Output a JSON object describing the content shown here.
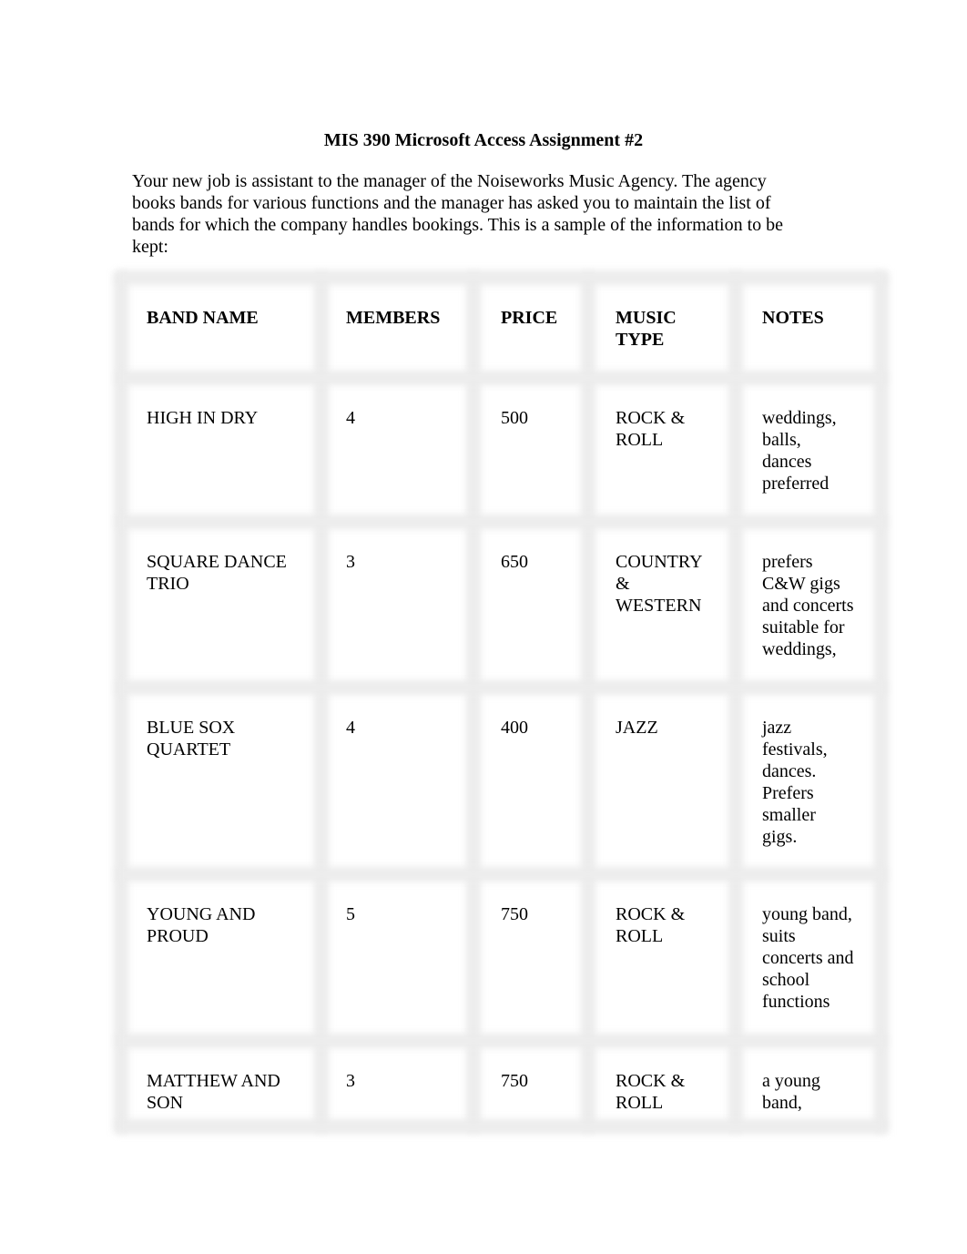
{
  "document": {
    "title": "MIS 390 Microsoft Access Assignment #2",
    "intro_lines": [
      "Your new job is assistant to the manager of the Noiseworks Music Agency. The agency",
      "books bands for various functions and the manager has asked you to maintain the list of",
      "bands for which the company handles bookings. This is a sample of the information to be",
      "kept:"
    ]
  },
  "table": {
    "headers": [
      [
        "BAND NAME"
      ],
      [
        "MEMBERS"
      ],
      [
        "PRICE"
      ],
      [
        "MUSIC",
        "TYPE"
      ],
      [
        "NOTES"
      ]
    ],
    "rows": [
      {
        "band_name": [
          "HIGH IN DRY"
        ],
        "members": "4",
        "price": "500",
        "music_type": [
          "ROCK &",
          "ROLL"
        ],
        "notes": [
          "weddings,",
          "balls,",
          "dances",
          "preferred"
        ]
      },
      {
        "band_name": [
          "SQUARE DANCE",
          "TRIO"
        ],
        "members": "3",
        "price": "650",
        "music_type": [
          "COUNTRY",
          "&",
          "WESTERN"
        ],
        "notes": [
          "prefers",
          "C&W gigs",
          "and concerts",
          "suitable for",
          "weddings,"
        ]
      },
      {
        "band_name": [
          "BLUE SOX",
          "QUARTET"
        ],
        "members": "4",
        "price": "400",
        "music_type": [
          "JAZZ"
        ],
        "notes": [
          "jazz",
          "festivals,",
          "dances.",
          "Prefers",
          "smaller",
          "gigs."
        ]
      },
      {
        "band_name": [
          "YOUNG AND",
          "PROUD"
        ],
        "members": "5",
        "price": "750",
        "music_type": [
          "ROCK &",
          "ROLL"
        ],
        "notes": [
          "young band,",
          "suits",
          "concerts and",
          "school",
          "functions"
        ]
      },
      {
        "band_name": [
          "MATTHEW AND",
          "SON"
        ],
        "members": "3",
        "price": "750",
        "music_type": [
          "ROCK &",
          "ROLL"
        ],
        "notes": [
          "a young",
          "band,"
        ]
      }
    ]
  }
}
